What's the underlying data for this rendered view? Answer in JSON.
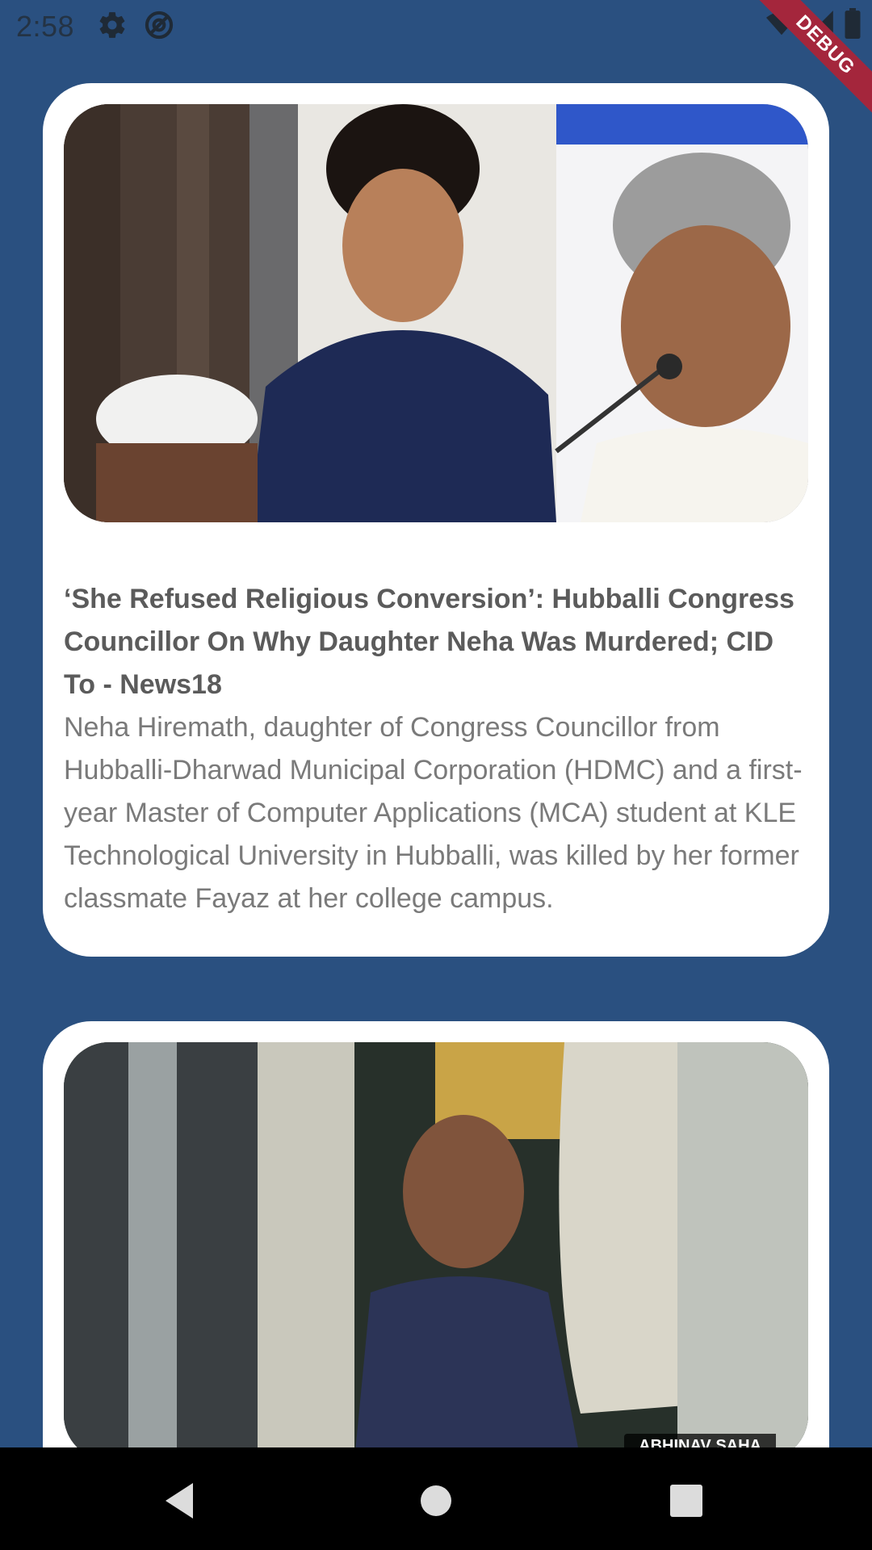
{
  "status_bar": {
    "time": "2:58",
    "icons": [
      "gear-icon",
      "at-icon",
      "wifi-icon",
      "signal-icon",
      "battery-icon"
    ]
  },
  "debug_banner": {
    "label": "DEBUG"
  },
  "news": [
    {
      "title": "‘She Refused Religious Conversion’: Hubballi Congress Councillor On Why Daughter Neha Was Murdered; CID To - News18",
      "description": "Neha Hiremath, daughter of Congress Councillor from Hubballi-Dharwad Municipal Corporation (HDMC) and a first-year Master of Computer Applications (MCA) student at KLE Technological University in Hubballi, was killed by her former classmate Fayaz at her college campus."
    },
    {
      "image_credit": "ABHINAV SAHA"
    }
  ],
  "colors": {
    "background": "#2a5080",
    "card": "#ffffff",
    "title": "#5b5b5b",
    "description": "#7a7a7a",
    "debug_ribbon": "#a4263c"
  }
}
